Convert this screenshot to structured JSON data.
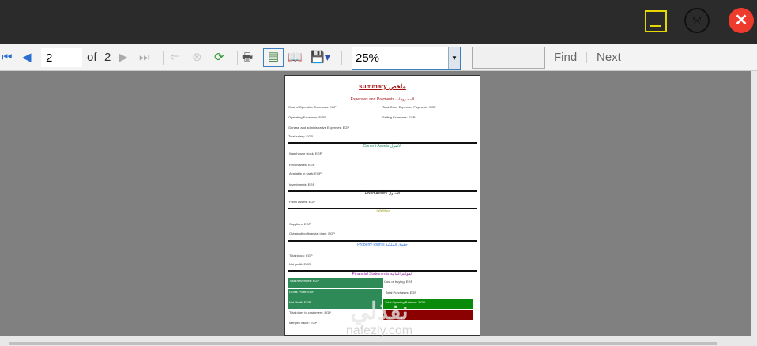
{
  "window": {
    "minimize_icon": "minimize-icon",
    "fullscreen_icon": "fullscreen-icon",
    "close_icon": "close-icon",
    "close_color": "#ef3b2d",
    "accent": "#e5d800"
  },
  "toolbar": {
    "current_page": "2",
    "of_label": "of",
    "total_pages": "2",
    "zoom": "25%",
    "find_value": "",
    "find_label": "Find",
    "next_label": "Next"
  },
  "report": {
    "title": "summary ملخص",
    "sections": [
      "Expenses and Payments المصروفات",
      "Current Assets الأصول",
      "Fixed Assets الأصول",
      "Liabilities",
      "Property Rights حقوق الملكية",
      "Financial Statements القوائم المالية"
    ],
    "lines": [
      "Cost of Operation Expenses: EGP",
      "Total Other Expenses Payments: EGP",
      "Operating Expenses: EGP",
      "Selling Expenses: EGP",
      "General and administrative Expenses: EGP",
      "Total salary: EGP",
      "Warehouse stock: EGP",
      "Receivables: EGP",
      "Available in cash: EGP",
      "Investments: EGP",
      "Fixed assets: EGP",
      "Suppliers: EGP",
      "Outstanding financial dues: EGP",
      "Total stock: EGP",
      "Net profit: EGP",
      "Total Revenues: EGP",
      "Cost of buying: EGP",
      "Gross Profit: EGP",
      "Total Purchases: EGP",
      "Net Profit: EGP",
      "Total Opening Balance: EGP",
      "Total dues to customers: EGP",
      "Merged Value: EGP"
    ]
  },
  "watermark": {
    "arabic": "نفذلي",
    "latin": "nafezly.com"
  }
}
